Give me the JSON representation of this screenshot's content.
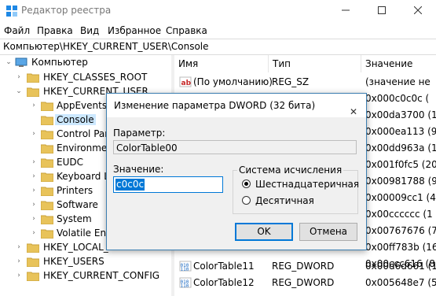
{
  "window": {
    "title": "Редактор реестра"
  },
  "menu": [
    "Файл",
    "Правка",
    "Вид",
    "Избранное",
    "Справка"
  ],
  "address": "Компьютер\\HKEY_CURRENT_USER\\Console",
  "tree": {
    "root": "Компьютер",
    "hives": [
      "HKEY_CLASSES_ROOT",
      "HKEY_CURRENT_USER"
    ],
    "hkcu_children": [
      "AppEvents",
      "Console",
      "Control Pan",
      "Environmen",
      "EUDC",
      "Keyboard La",
      "Printers",
      "Software",
      "System",
      "Volatile Envi"
    ],
    "hives_after": [
      "HKEY_LOCAL_MA",
      "HKEY_USERS",
      "HKEY_CURRENT_CONFIG"
    ]
  },
  "list": {
    "headers": [
      "Имя",
      "Тип",
      "Значение"
    ],
    "default_row": {
      "name": "(По умолчанию)",
      "type": "REG_SZ",
      "value": "(значение не"
    },
    "values_col": [
      "0x000c0c0c (",
      "0x00da3700 (1",
      "0x000ea113 (9",
      "0x00dd963a (1",
      "0x001f0fc5 (20",
      "0x00981788 (9",
      "0x00009cc1 (4",
      "0x00cccccc (1",
      "0x00767676 (7",
      "0x00ff783b (16",
      "0x00ccc616 (8"
    ],
    "bottom_rows": [
      {
        "name": "ColorTable11",
        "type": "REG_DWORD",
        "value": "0x00d6d661 (1"
      },
      {
        "name": "ColorTable12",
        "type": "REG_DWORD",
        "value": "0x005648e7 (5"
      }
    ]
  },
  "dialog": {
    "title": "Изменение параметра DWORD (32 бита)",
    "close": "✕",
    "param_label": "Параметр:",
    "param_value": "ColorTable00",
    "value_label": "Значение:",
    "value_data": "c0c0c",
    "base_label": "Система исчисления",
    "radio_hex": "Шестнадцатеричная",
    "radio_dec": "Десятичная",
    "ok": "OK",
    "cancel": "Отмена"
  },
  "colors": {
    "folder": "#e8c35a",
    "selection": "#cce8ff",
    "accent": "#0078d7"
  }
}
